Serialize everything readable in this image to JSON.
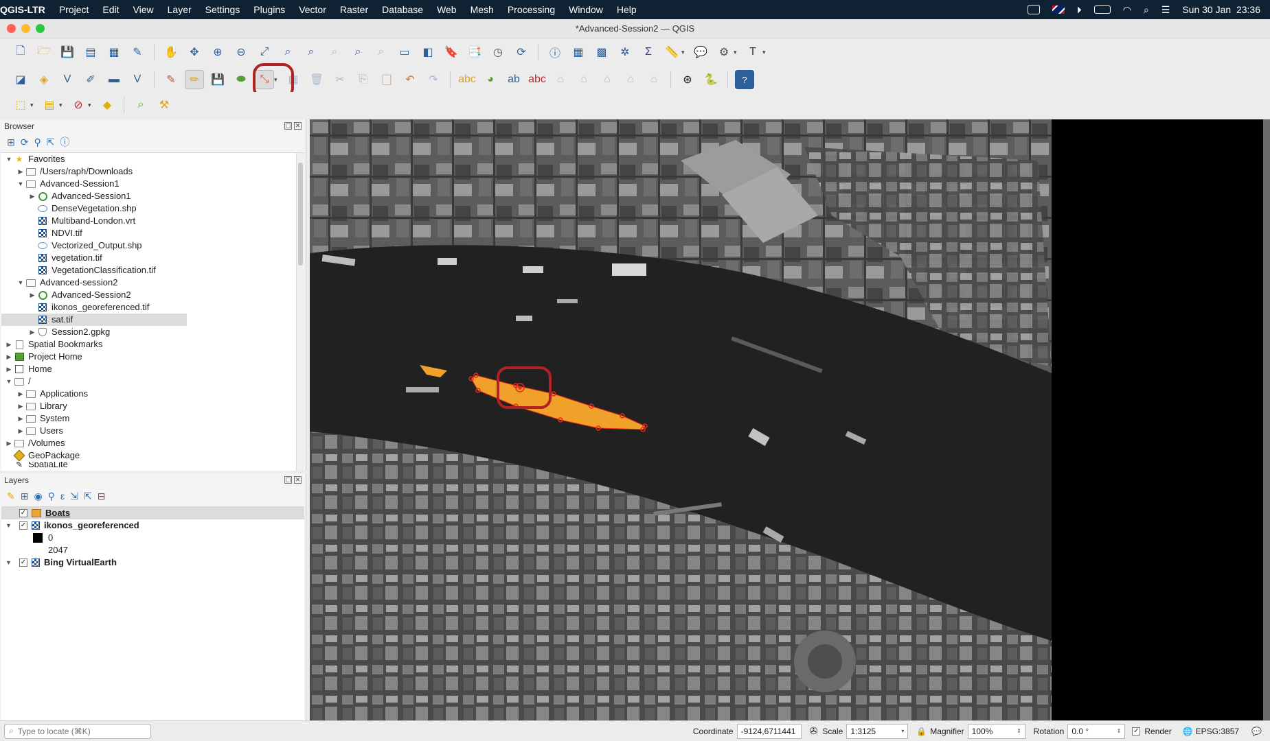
{
  "menubar": {
    "app": "QGIS-LTR",
    "items": [
      "Project",
      "Edit",
      "View",
      "Layer",
      "Settings",
      "Plugins",
      "Vector",
      "Raster",
      "Database",
      "Web",
      "Mesh",
      "Processing",
      "Window",
      "Help"
    ],
    "clock": "Sun 30 Jan  23:36"
  },
  "window": {
    "title": "*Advanced-Session2 — QGIS"
  },
  "browser": {
    "title": "Browser",
    "items": [
      "Favorites",
      "/Users/raph/Downloads",
      "Advanced-Session1",
      "Advanced-Session1",
      "DenseVegetation.shp",
      "Multiband-London.vrt",
      "NDVI.tif",
      "Vectorized_Output.shp",
      "vegetation.tif",
      "VegetationClassification.tif",
      "Advanced-session2",
      "Advanced-Session2",
      "ikonos_georeferenced.tif",
      "sat.tif",
      "Session2.gpkg",
      "Spatial Bookmarks",
      "Project Home",
      "Home",
      "/",
      "Applications",
      "Library",
      "System",
      "Users",
      "/Volumes",
      "GeoPackage",
      "SpatiaLite"
    ]
  },
  "layers": {
    "title": "Layers",
    "items": [
      "Boats",
      "ikonos_georeferenced",
      "0",
      "2047",
      "Bing VirtualEarth"
    ]
  },
  "status": {
    "locate_placeholder": "Type to locate (⌘K)",
    "coordinate_label": "Coordinate",
    "coordinate_value": "-9124,6711441",
    "scale_label": "Scale",
    "scale_value": "1:3125",
    "magnifier_label": "Magnifier",
    "magnifier_value": "100%",
    "rotation_label": "Rotation",
    "rotation_value": "0.0 °",
    "render_label": "Render",
    "crs": "EPSG:3857"
  },
  "colors": {
    "feature_fill": "#f0a12a",
    "vertex_marker": "#e8271b",
    "highlight_ring": "#b22222",
    "menubar_bg": "#0f2233"
  }
}
